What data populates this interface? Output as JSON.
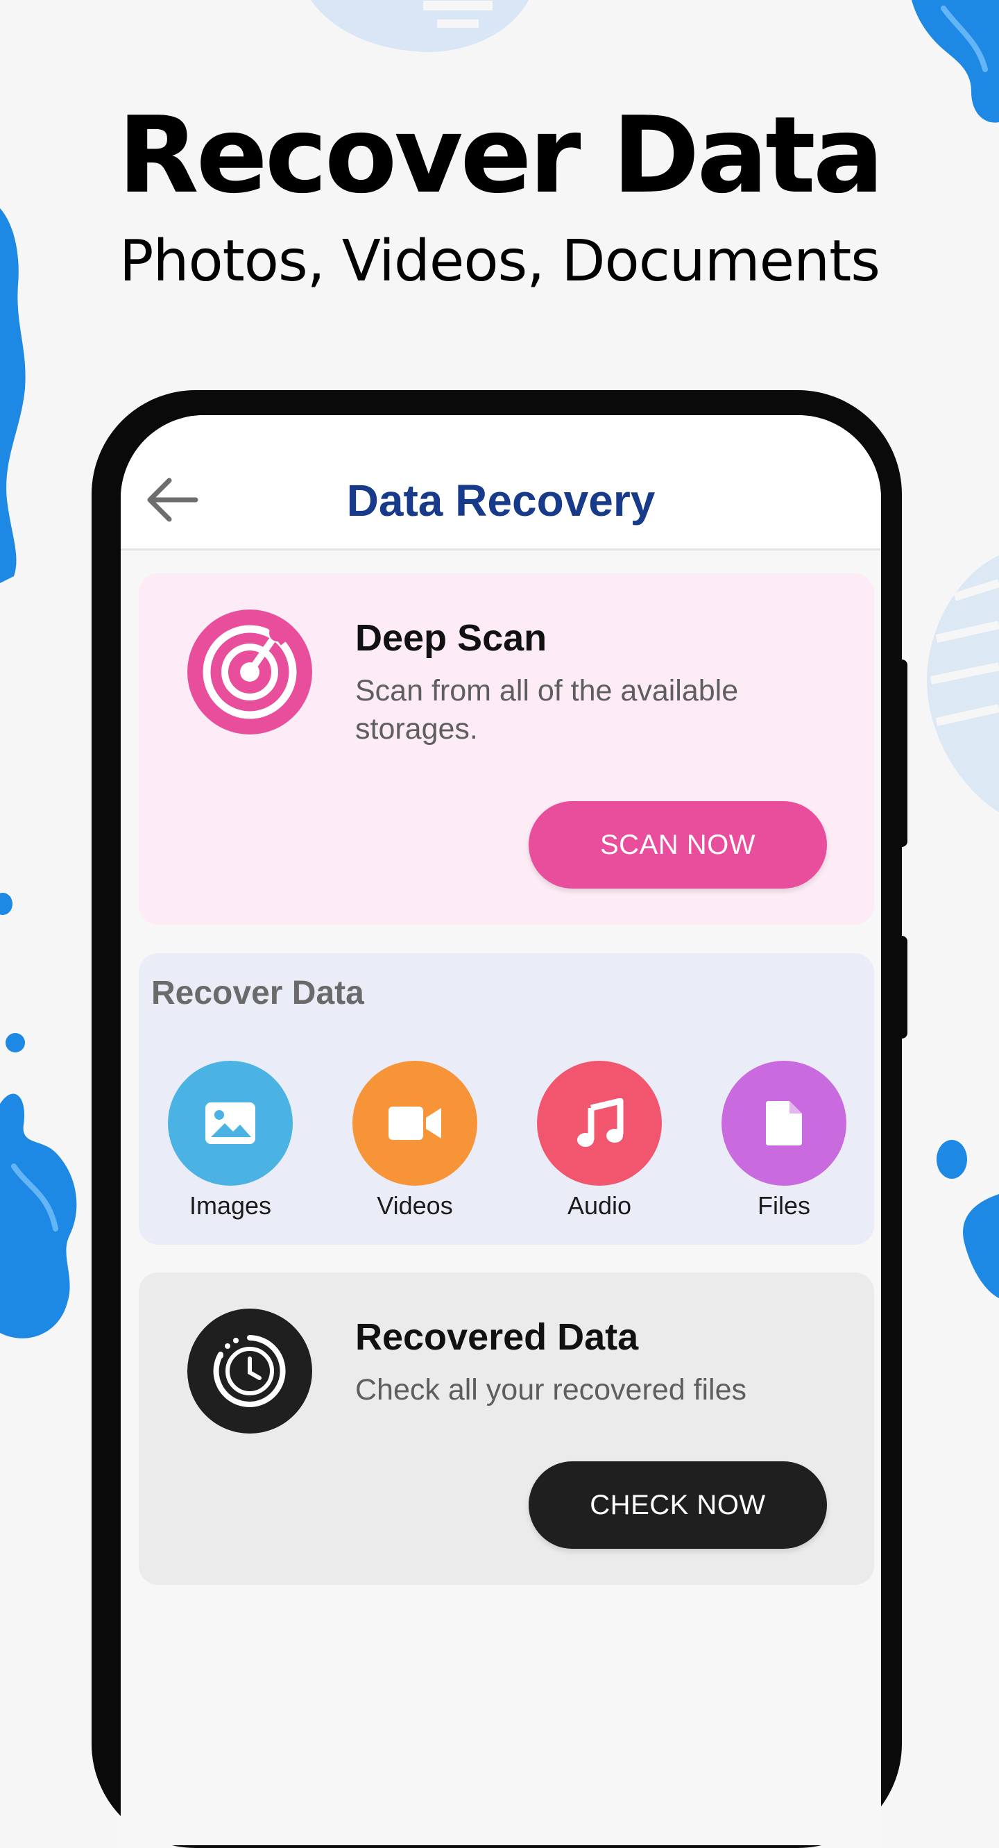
{
  "promo": {
    "headline": "Recover Data",
    "subheadline": "Photos, Videos, Documents"
  },
  "appbar": {
    "title": "Data Recovery",
    "back_icon": "arrow-back-icon"
  },
  "deep_scan": {
    "icon": "radar-icon",
    "title": "Deep Scan",
    "description": "Scan from all of the available storages.",
    "button_label": "SCAN NOW",
    "accent_color": "#e94e9c",
    "card_color": "#fdecf5"
  },
  "recover_data": {
    "title": "Recover Data",
    "items": [
      {
        "label": "Images",
        "icon": "image-icon",
        "color": "#4ab3e3"
      },
      {
        "label": "Videos",
        "icon": "video-camera-icon",
        "color": "#f79438"
      },
      {
        "label": "Audio",
        "icon": "music-note-icon",
        "color": "#f2566e"
      },
      {
        "label": "Files",
        "icon": "file-icon",
        "color": "#c96adf"
      }
    ]
  },
  "recovered_data": {
    "icon": "history-clock-icon",
    "title": "Recovered Data",
    "description": "Check all your recovered files",
    "button_label": "CHECK NOW",
    "accent_color": "#1f1f1f"
  },
  "theme": {
    "title_color": "#173a8a",
    "background": "#f6f6f7"
  }
}
